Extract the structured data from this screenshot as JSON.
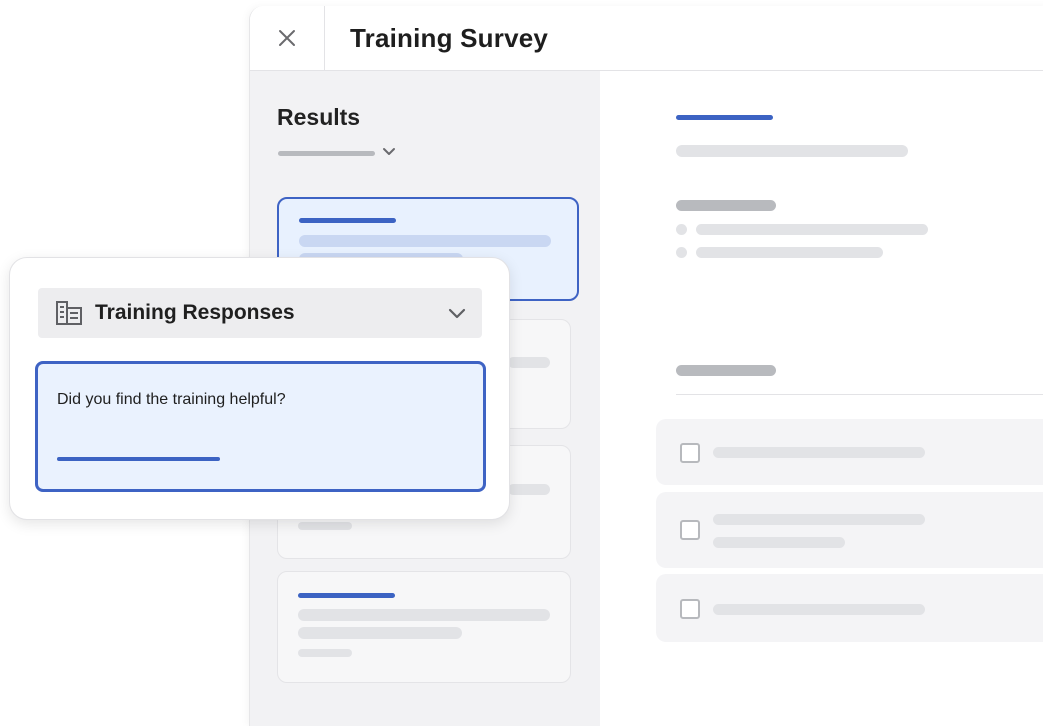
{
  "window": {
    "title": "Training Survey",
    "close_icon": "close-icon"
  },
  "results": {
    "title": "Results",
    "filter_icon": "chevron-down-icon"
  },
  "panel": {
    "dropdown_icon": "table-grid-icon",
    "dropdown_label": "Training Responses",
    "dropdown_chevron": "chevron-down-icon",
    "question": "Did you find the training helpful?"
  },
  "colors": {
    "accent": "#3e63c4",
    "selected_bg": "#e8f1fe",
    "skeleton": "#e2e3e6",
    "skeleton_dark": "#b8babe",
    "pane_bg": "#f2f2f4"
  }
}
